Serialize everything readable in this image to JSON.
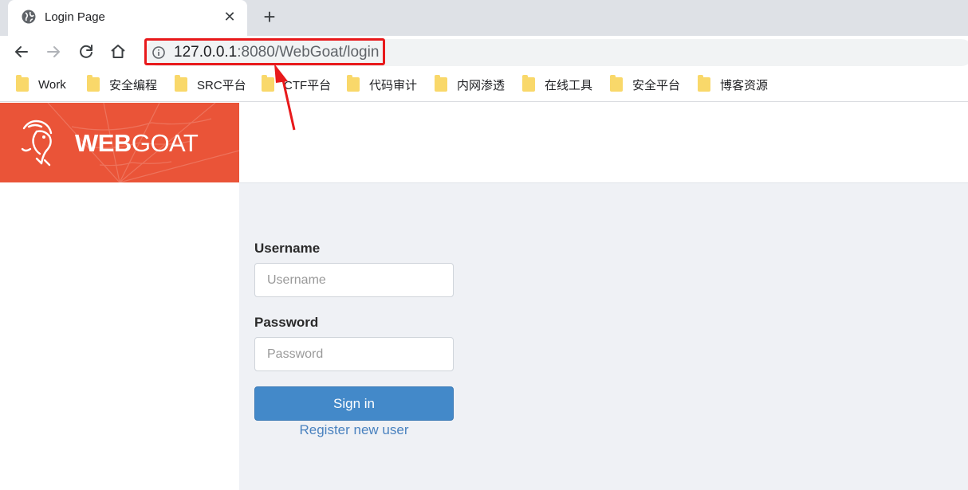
{
  "tab": {
    "title": "Login Page",
    "close": "✕",
    "new_tab": "+"
  },
  "address_bar": {
    "url_host": "127.0.0.1",
    "url_rest": ":8080/WebGoat/login"
  },
  "bookmarks": [
    {
      "label": "Work"
    },
    {
      "label": "安全编程"
    },
    {
      "label": "SRC平台"
    },
    {
      "label": "CTF平台"
    },
    {
      "label": "代码审计"
    },
    {
      "label": "内网渗透"
    },
    {
      "label": "在线工具"
    },
    {
      "label": "安全平台"
    },
    {
      "label": "博客资源"
    }
  ],
  "brand": {
    "web": "WEB",
    "goat": "GOAT"
  },
  "login": {
    "username_label": "Username",
    "username_placeholder": "Username",
    "password_label": "Password",
    "password_placeholder": "Password",
    "signin_label": "Sign in",
    "register_label": "Register new user"
  },
  "colors": {
    "brand": "#ea5438",
    "button": "#4389c9",
    "highlight": "#e8191b",
    "link": "#4a82bf"
  }
}
